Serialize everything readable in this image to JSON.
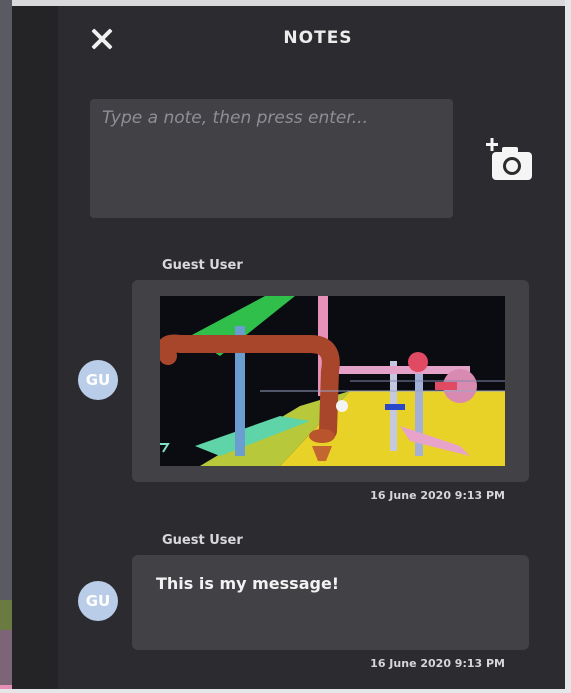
{
  "header": {
    "title": "NOTES"
  },
  "composer": {
    "placeholder": "Type a note, then press enter..."
  },
  "notes": [
    {
      "author": "Guest User",
      "initials": "GU",
      "has_image": true,
      "timestamp": "16 June 2020 9:13 PM"
    },
    {
      "author": "Guest User",
      "initials": "GU",
      "text": "This is my message!",
      "timestamp": "16 June 2020 9:13 PM"
    }
  ],
  "colors": {
    "panel": "#2c2c30",
    "input": "#414146",
    "avatar": "#b9cde8"
  },
  "icons": {
    "close": "close-icon",
    "camera": "add-photo-icon"
  }
}
